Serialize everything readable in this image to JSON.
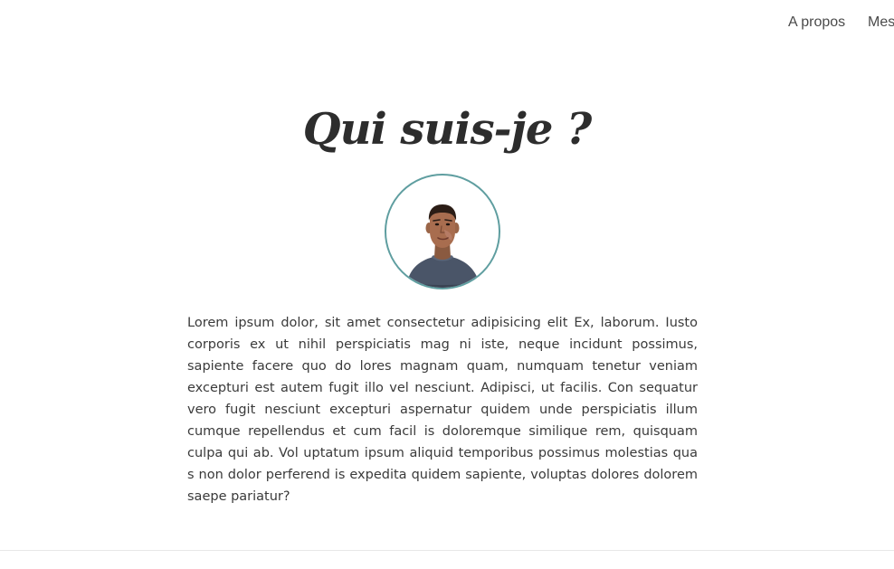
{
  "nav": {
    "items": [
      {
        "label": "A propos"
      },
      {
        "label": "Mes"
      }
    ]
  },
  "section": {
    "title": "Qui suis-je ?",
    "avatar_icon": "person-avatar-icon",
    "avatar_border_color": "#5f9ea0",
    "bio": "Lorem ipsum dolor, sit amet consectetur adipisicing elit Ex, laborum. Iusto corporis ex ut nihil perspiciatis mag ni iste, neque incidunt possimus, sapiente facere quo do lores magnam quam, numquam tenetur veniam excepturi est autem fugit illo vel nesciunt. Adipisci, ut facilis. Con sequatur vero fugit nesciunt excepturi aspernatur quidem unde perspiciatis illum cumque repellendus et cum facil is doloremque similique rem, quisquam culpa qui ab. Vol uptatum ipsum aliquid temporibus possimus molestias qua s non dolor perferend is expedita quidem sapiente, voluptas dolores dolorem saepe pariatur?"
  }
}
